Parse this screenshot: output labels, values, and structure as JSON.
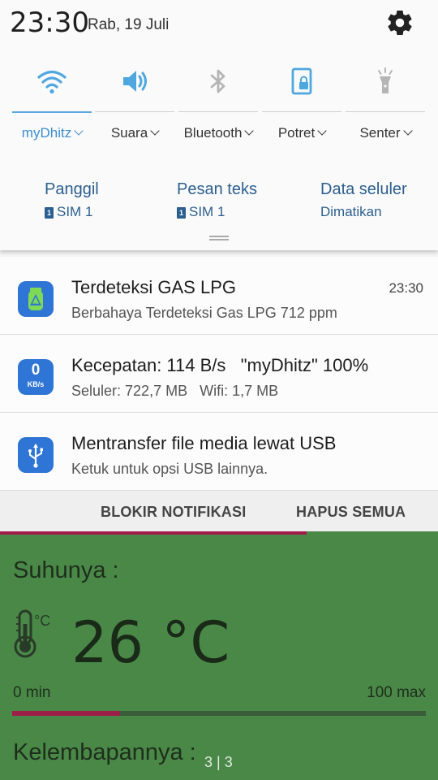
{
  "status": {
    "time": "23:30",
    "date": "Rab, 19 Juli"
  },
  "quick_settings": [
    {
      "label": "myDhitz",
      "icon": "wifi-icon",
      "active": true
    },
    {
      "label": "Suara",
      "icon": "volume-icon",
      "active": false
    },
    {
      "label": "Bluetooth",
      "icon": "bluetooth-icon",
      "active": false
    },
    {
      "label": "Potret",
      "icon": "rotation-lock-icon",
      "active": false
    },
    {
      "label": "Senter",
      "icon": "flashlight-icon",
      "active": false
    }
  ],
  "sim_actions": {
    "call": {
      "label": "Panggil",
      "sim": "SIM 1",
      "badge": "1"
    },
    "sms": {
      "label": "Pesan teks",
      "sim": "SIM 1",
      "badge": "1"
    },
    "data": {
      "label": "Data seluler",
      "status": "Dimatikan"
    }
  },
  "notifications": [
    {
      "title": "Terdeteksi GAS LPG",
      "text": "Berbahaya Terdeteksi Gas LPG 712 ppm",
      "time": "23:30",
      "icon": "gas-alert-icon"
    },
    {
      "title": "Kecepatan: 114 B/s   \"myDhitz\" 100%",
      "text": "Seluler: 722,7 MB   Wifi: 1,7 MB",
      "icon": "network-speed-icon",
      "icon_value": "0",
      "icon_unit": "KB/s"
    },
    {
      "title": "Mentransfer file media lewat USB",
      "text": "Ketuk untuk opsi USB lainnya.",
      "icon": "usb-icon"
    }
  ],
  "actions": {
    "block": "BLOKIR NOTIFIKASI",
    "clear": "HAPUS SEMUA"
  },
  "app": {
    "temp_label": "Suhunya :",
    "temp_value": "26 °C",
    "thermo_unit": "°C",
    "min_label": "0 min",
    "max_label": "100 max",
    "temp_fraction": 0.26,
    "humidity_label": "Kelembapannya :",
    "page_indicator": "3 | 3"
  },
  "colors": {
    "accent": "#3b8ed0",
    "app_bg": "#4a8848",
    "progress": "#9e1e4a"
  }
}
